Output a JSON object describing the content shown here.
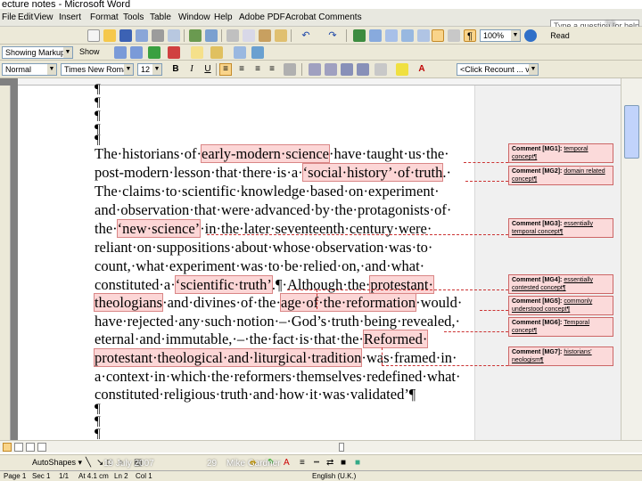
{
  "window": {
    "title": "ecture notes - Microsoft Word"
  },
  "menu": {
    "items": [
      "File",
      "Edit",
      "View",
      "Insert",
      "Format",
      "Tools",
      "Table",
      "Window",
      "Help",
      "Adobe PDF",
      "Acrobat Comments"
    ],
    "ask_placeholder": "Type a question for help",
    "slide_number": "29"
  },
  "standard_toolbar": {
    "zoom": "100%",
    "read_label": "Read"
  },
  "reviewing_toolbar": {
    "display_mode": "Showing Markup",
    "show_label": "Show"
  },
  "formatting_toolbar": {
    "style": "Normal",
    "font": "Times New Roman",
    "size": "12",
    "bold": "B",
    "italic": "I",
    "underline": "U",
    "reviewer_combo": "<Click Recount ... view >"
  },
  "document": {
    "lines": [
      [
        {
          "t": "The·historians·of·"
        },
        {
          "t": "early-modern·science",
          "h": true
        },
        {
          "t": "·have·taught·us·the·"
        }
      ],
      [
        {
          "t": "post-modern·lesson·that·there·is·a·"
        },
        {
          "t": "‘social·history’·of·truth",
          "h": true
        },
        {
          "t": ".·"
        }
      ],
      [
        {
          "t": "The·claims·to·scientific·knowledge·based·on·experiment·"
        }
      ],
      [
        {
          "t": "and·observation·that·were·advanced·by·the·protagonists·of·"
        }
      ],
      [
        {
          "t": "the·"
        },
        {
          "t": "‘new·science’",
          "h": true
        },
        {
          "t": "·in·the·later·seventeenth·century·were·"
        }
      ],
      [
        {
          "t": "reliant·on·suppositions·about·whose·observation·was·to·"
        }
      ],
      [
        {
          "t": "count,·what·experiment·was·to·be·relied·on,·and·what·"
        }
      ],
      [
        {
          "t": "constituted·a·"
        },
        {
          "t": "‘scientific·truth’",
          "h": true
        },
        {
          "t": ".¶·Although·the·"
        },
        {
          "t": "protestant·",
          "h": true
        }
      ],
      [
        {
          "t": "theologians",
          "h": true
        },
        {
          "t": "·and·divines·of·the·"
        },
        {
          "t": "age·of·the·reformation",
          "h": true
        },
        {
          "t": "·would·"
        }
      ],
      [
        {
          "t": "have·rejected·any·such·notion·–·God’s·truth·being·revealed,·"
        }
      ],
      [
        {
          "t": "eternal·and·immutable,·–·the·fact·is·that·the·"
        },
        {
          "t": "Reformed·",
          "h": true
        }
      ],
      [
        {
          "t": "protestant·theological·and·liturgical·tradition",
          "h": true
        },
        {
          "t": "·was·framed·in·"
        }
      ],
      [
        {
          "t": "a·context·in·which·the·reformers·themselves·redefined·what·"
        }
      ],
      [
        {
          "t": "constituted·religious·truth·and·how·it·was·validated’¶"
        }
      ]
    ],
    "pilcrow": "¶"
  },
  "comments": [
    {
      "label": "Comment [MG1]:",
      "text": "temporal concept¶"
    },
    {
      "label": "Comment [MG2]:",
      "text": "domain related concept¶"
    },
    {
      "label": "Comment [MG3]:",
      "text": "essentially temporal concept¶"
    },
    {
      "label": "Comment [MG4]:",
      "text": "essentially contested concept¶"
    },
    {
      "label": "Comment [MG5]:",
      "text": "commonly understood concept¶"
    },
    {
      "label": "Comment [MG6]:",
      "text": "Temporal concept¶"
    },
    {
      "label": "Comment [MG7]:",
      "text": "historians' neologism¶"
    }
  ],
  "drawing_toolbar": {
    "autoshapes": "AutoShapes ▾"
  },
  "overlay": {
    "date": "19 July 2007",
    "page_num": "29",
    "author": "Mike Gardner"
  },
  "status_bar": {
    "page": "Page 1",
    "sec": "Sec 1",
    "pos": "1/1",
    "at": "At 4.1 cm",
    "ln": "Ln 2",
    "col": "Col 1",
    "lang": "English (U.K.)"
  },
  "colors": {
    "highlight": "#fcd6d6",
    "comment_fill": "#fbdada",
    "comment_border": "#cc6666",
    "toolbar": "#ece9d8"
  }
}
